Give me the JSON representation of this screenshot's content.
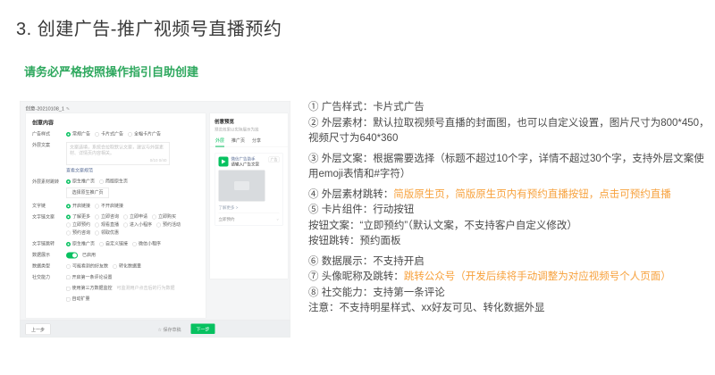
{
  "page": {
    "title": "3. 创建广告-推广视频号直播预约",
    "subtitle": "请务必严格按照操作指引自助创建"
  },
  "colors": {
    "accent_green": "#07c160",
    "subtitle_green": "#2ea85e",
    "highlight_orange": "#f7a13c"
  },
  "screenshot": {
    "breadcrumb": "创意-20210108_1",
    "edit_icon": "✎",
    "form": {
      "panel_title": "创意内容",
      "rows": [
        {
          "label": "广告样式",
          "type": "radio",
          "options": [
            {
              "t": "常规广告",
              "on": true
            },
            {
              "t": "卡片式广告"
            },
            {
              "t": "全幅卡片广告"
            }
          ]
        },
        {
          "label": "外层文案",
          "type": "textarea",
          "placeholder": "文案选填，系统会拉取默认文案，建议与外层素材、详情页内容相关。",
          "counters": "0/10  0/40",
          "link": "查看文案规范"
        },
        {
          "label": "外层素材跳转",
          "type": "radio",
          "options": [
            {
              "t": "原生推广页",
              "on": true
            },
            {
              "t": "简版原生页"
            }
          ],
          "button": "选择原生推广页"
        },
        {
          "label": "文字链",
          "type": "radio",
          "options": [
            {
              "t": "开启链接",
              "on": true
            },
            {
              "t": "不开启链接"
            }
          ]
        },
        {
          "label": "文字链文案",
          "type": "radio",
          "options": [
            {
              "t": "了解更多",
              "on": true
            },
            {
              "t": "立即咨询"
            },
            {
              "t": "立即申请"
            },
            {
              "t": "立即购买"
            },
            {
              "t": "立即预约"
            },
            {
              "t": "观看直播"
            },
            {
              "t": "进入小程序"
            },
            {
              "t": "预约活动"
            },
            {
              "t": "预约咨询"
            },
            {
              "t": "领取优惠"
            }
          ]
        },
        {
          "label": "文字链跳转",
          "type": "radio",
          "options": [
            {
              "t": "原生推广页",
              "on": true
            },
            {
              "t": "自定义链接"
            },
            {
              "t": "微信小程序"
            }
          ]
        },
        {
          "label": "数据展示",
          "type": "toggle",
          "value": "已启用"
        },
        {
          "label": "数据类型",
          "type": "radio",
          "options": [
            {
              "t": "可能看到的好友数"
            },
            {
              "t": "转化数据量"
            }
          ]
        },
        {
          "label": "社交能力",
          "type": "checkbox",
          "options": [
            {
              "t": "开启第一条评论设置"
            }
          ]
        },
        {
          "label": "",
          "type": "checkbox",
          "options": [
            {
              "t": "使用第三方数据监控",
              "note": "可监测用户点击后的行为数据"
            }
          ]
        },
        {
          "label": "",
          "type": "checkbox",
          "options": [
            {
              "t": "自动扩量"
            }
          ]
        }
      ]
    },
    "preview": {
      "title": "创意预览",
      "subtitle": "预览效果以实际展示为准",
      "tabs": [
        {
          "t": "外层",
          "active": true
        },
        {
          "t": "推广页"
        },
        {
          "t": "分享"
        }
      ],
      "card": {
        "brand": "微信广告助手",
        "text_placeholder": "请输入广告文案",
        "ad_tag": "广告",
        "link_line": "了解更多 >",
        "action_line": "立即预约",
        "chevron": "⌄"
      }
    },
    "footer": {
      "prev": "上一步",
      "draft_star": "☆",
      "draft": "保存草稿",
      "next": "下一步"
    }
  },
  "instructions": {
    "items": [
      {
        "parts": [
          {
            "t": "① 广告样式：卡片式广告",
            "c": "dark"
          }
        ]
      },
      {
        "parts": [
          {
            "t": "② 外层素材：默认拉取视频号直播的封面图，也可以自定义设置，图片尺寸为800*450，视频尺寸为640*360",
            "c": "dark"
          }
        ]
      },
      {
        "gap": true,
        "parts": [
          {
            "t": "③ 外层文案：根据需要选择（标题不超过10个字，详情不超过30个字，支持外层文案使用emoji表情和#字符）",
            "c": "dark"
          }
        ]
      },
      {
        "gap": true,
        "parts": [
          {
            "t": "④ 外层素材跳转：",
            "c": "dark"
          },
          {
            "t": "简版原生页，简版原生页内有预约直播按钮，点击可预约直播",
            "c": "orange"
          }
        ]
      },
      {
        "parts": [
          {
            "t": "⑤ 卡片组件：行动按钮",
            "c": "dark"
          }
        ]
      },
      {
        "parts": [
          {
            "t": "按钮文案：“立即预约”（默认文案，不支持客户自定义修改）",
            "c": "dark"
          }
        ]
      },
      {
        "parts": [
          {
            "t": "按钮跳转：预约面板",
            "c": "dark"
          }
        ]
      },
      {
        "gap": true,
        "parts": [
          {
            "t": "⑥ 数据展示：不支持开启",
            "c": "dark"
          }
        ]
      },
      {
        "parts": [
          {
            "t": "⑦ 头像昵称及跳转：",
            "c": "dark"
          },
          {
            "t": "跳转公众号（开发后续将手动调整为对应视频号个人页面）",
            "c": "orange"
          }
        ]
      },
      {
        "parts": [
          {
            "t": "⑧ 社交能力：支持第一条评论",
            "c": "dark"
          }
        ]
      },
      {
        "parts": [
          {
            "t": "注意：不支持明星样式、xx好友可见、转化数据外显",
            "c": "dark"
          }
        ]
      }
    ]
  }
}
